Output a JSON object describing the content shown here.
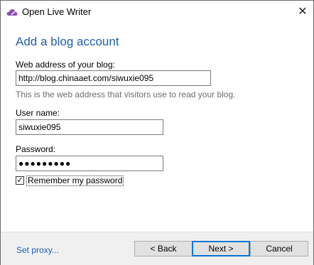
{
  "window": {
    "title": "Open Live Writer"
  },
  "page": {
    "heading": "Add a blog account",
    "web_address_label": "Web address of your blog:",
    "web_address_value": "http://blog.chinaaet.com/siwuxie095",
    "web_address_hint": "This is the web address that visitors use to read your blog.",
    "username_label": "User name:",
    "username_value": "siwuxie095",
    "password_label": "Password:",
    "password_value": "●●●●●●●●●",
    "remember_label": "Remember my password",
    "remember_checked": true
  },
  "footer": {
    "proxy_link": "Set proxy...",
    "back_label": "< Back",
    "next_label": "Next >",
    "cancel_label": "Cancel"
  },
  "colors": {
    "heading": "#1e5fa8",
    "link": "#1a5fb4",
    "footer_bg": "#f0f0f0",
    "focus_border": "#0078d7",
    "app_icon": "#8a4fb0"
  },
  "icons": {
    "app": "cloud-pen-icon",
    "close": "close-icon",
    "check": "checkmark-icon"
  }
}
